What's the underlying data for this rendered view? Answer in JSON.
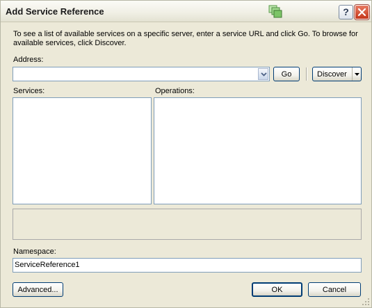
{
  "window": {
    "title": "Add Service Reference",
    "help_glyph": "?",
    "icons": {
      "app": "service-reference-icon",
      "help": "help-icon",
      "close": "close-icon"
    }
  },
  "instructions": "To see a list of available services on a specific server, enter a service URL and click Go. To browse for available services, click Discover.",
  "address": {
    "label": "Address:",
    "value": "",
    "go_label": "Go",
    "discover_label": "Discover"
  },
  "services": {
    "label": "Services:",
    "items": []
  },
  "operations": {
    "label": "Operations:",
    "items": []
  },
  "namespace": {
    "label": "Namespace:",
    "value": "ServiceReference1"
  },
  "buttons": {
    "advanced_label": "Advanced...",
    "ok_label": "OK",
    "cancel_label": "Cancel"
  },
  "colors": {
    "dialog_background": "#ece9d8",
    "field_border": "#7f9db9",
    "button_border": "#003c74",
    "close_button": "#c4361b"
  }
}
